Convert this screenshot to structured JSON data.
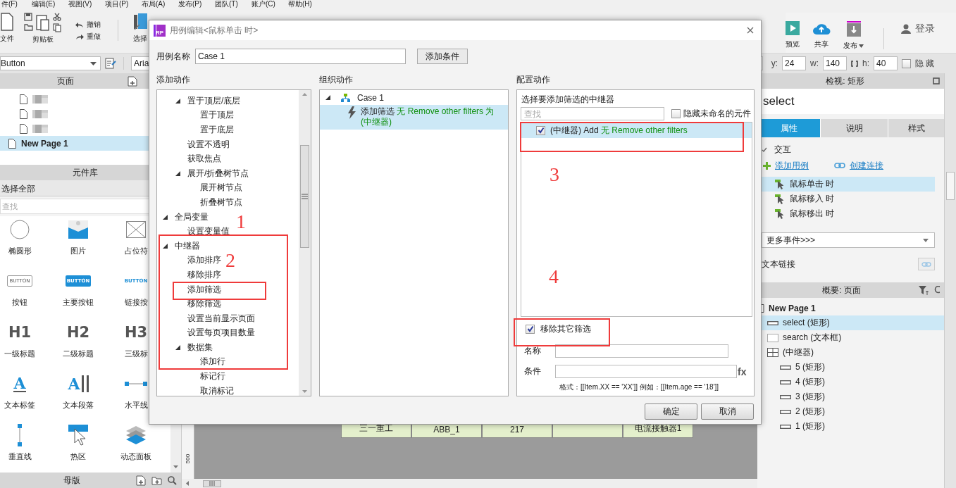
{
  "menu_bar": [
    "件(F)",
    "编辑(E)",
    "视图(V)",
    "项目(P)",
    "布局(A)",
    "发布(P)",
    "团队(T)",
    "账户(C)",
    "帮助(H)"
  ],
  "toolbar": {
    "left": [
      {
        "kind": "file",
        "label": "文件"
      },
      {
        "kind": "clipboard",
        "label": "剪贴板"
      },
      {
        "kind": "history",
        "items": [
          "撤销",
          "重做"
        ]
      },
      {
        "kind": "select",
        "label": "选择"
      }
    ],
    "right": [
      {
        "kind": "preview",
        "label": "预览"
      },
      {
        "kind": "share",
        "label": "共享"
      },
      {
        "kind": "publish",
        "label": "发布"
      }
    ],
    "login": "登录"
  },
  "property_bar": {
    "widget_type": "Button",
    "font": "Aria",
    "fields": [
      {
        "label": "y:",
        "value": "24"
      },
      {
        "label": "w:",
        "value": "140"
      },
      {
        "label": "h:",
        "value": "40"
      }
    ],
    "hidden": {
      "label": "隐藏",
      "checked": false
    }
  },
  "pages_panel": {
    "title": "页面",
    "pages": [
      {
        "kind": "obscured",
        "selected": false
      },
      {
        "kind": "obscured",
        "selected": false
      },
      {
        "kind": "obscured",
        "selected": false
      },
      {
        "kind": "page",
        "label": "New Page 1",
        "selected": true
      }
    ]
  },
  "library_panel": {
    "title": "元件库",
    "library": "选择全部",
    "search_placeholder": "查找",
    "widgets": [
      {
        "kind": "ellipse",
        "label": "椭圆形"
      },
      {
        "kind": "image",
        "label": "图片"
      },
      {
        "kind": "placeholder",
        "label": "占位符"
      },
      {
        "kind": "button",
        "glyph": "BUTTON",
        "label": "按钮"
      },
      {
        "kind": "primary-button",
        "glyph": "BUTTON",
        "label": "主要按钮"
      },
      {
        "kind": "link-button",
        "glyph": "BUTTON",
        "label": "链接按"
      },
      {
        "kind": "heading",
        "glyph": "H1",
        "label": "一级标题"
      },
      {
        "kind": "heading",
        "glyph": "H2",
        "label": "二级标题"
      },
      {
        "kind": "heading",
        "glyph": "H3",
        "label": "三级标"
      },
      {
        "kind": "text-label",
        "glyph": "A",
        "label": "文本标签"
      },
      {
        "kind": "paragraph",
        "glyph": "A",
        "label": "文本段落"
      },
      {
        "kind": "hline",
        "label": "水平线"
      },
      {
        "kind": "vline",
        "label": "垂直线"
      },
      {
        "kind": "hotspot",
        "label": "热区"
      },
      {
        "kind": "dynamic-panel",
        "label": "动态面板"
      }
    ]
  },
  "masters_panel": {
    "title": "母版"
  },
  "canvas": {
    "ruler_label": "500",
    "table_cells": [
      {
        "text": "三一重工"
      },
      {
        "text": "ABB_1"
      },
      {
        "text": "217"
      },
      {},
      {
        "text": "电流接触器1"
      }
    ]
  },
  "inspector": {
    "title": "检视: 矩形",
    "name": "select",
    "tabs": [
      {
        "label": "属性",
        "selected": true
      },
      {
        "label": "说明",
        "selected": false
      },
      {
        "label": "样式",
        "selected": false
      }
    ],
    "section": "交互",
    "add_case": "添加用例",
    "create_link": "创建连接",
    "events": [
      {
        "label": "鼠标单击 时",
        "selected": true
      },
      {
        "label": "鼠标移入 时",
        "selected": false
      },
      {
        "label": "鼠标移出 时",
        "selected": false
      }
    ],
    "more_events": "更多事件>>>",
    "text_link": "文本链接"
  },
  "outline": {
    "title": "概要: 页面",
    "tree": [
      {
        "kind": "page",
        "label": "New Page 1",
        "selected": false,
        "children": [
          {
            "kind": "rect",
            "label": "select (矩形)",
            "selected": true
          },
          {
            "kind": "textbox",
            "label": "search (文本框)",
            "selected": false
          },
          {
            "kind": "repeater",
            "label": "(中继器)",
            "selected": false,
            "children": [
              {
                "kind": "rect",
                "label": "5 (矩形)",
                "selected": false
              },
              {
                "kind": "rect",
                "label": "4 (矩形)",
                "selected": false
              },
              {
                "kind": "rect",
                "label": "3 (矩形)",
                "selected": false
              },
              {
                "kind": "rect",
                "label": "2 (矩形)",
                "selected": false
              },
              {
                "kind": "rect",
                "label": "1 (矩形)",
                "selected": false
              }
            ]
          }
        ]
      }
    ]
  },
  "dialog": {
    "logo": "RP",
    "title": "用例编辑<鼠标单击 时>",
    "case_name_label": "用例名称",
    "case_name": "Case 1",
    "add_condition": "添加条件",
    "add_actions": {
      "title": "添加动作",
      "tree": [
        {
          "children": [
            {
              "label": "置于顶层/底层",
              "expanded": true,
              "children": [
                {
                  "label": "置于顶层"
                },
                {
                  "label": "置于底层"
                }
              ]
            },
            {
              "label": "设置不透明"
            },
            {
              "label": "获取焦点"
            },
            {
              "label": "展开/折叠树节点",
              "expanded": true,
              "children": [
                {
                  "label": "展开树节点"
                },
                {
                  "label": "折叠树节点"
                }
              ]
            }
          ]
        },
        {
          "label": "全局变量",
          "expanded": true,
          "children": [
            {
              "label": "设置变量值"
            }
          ]
        },
        {
          "label": "中继器",
          "expanded": true,
          "children": [
            {
              "label": "添加排序"
            },
            {
              "label": "移除排序"
            },
            {
              "label": "添加筛选"
            },
            {
              "label": "移除筛选"
            },
            {
              "label": "设置当前显示页面"
            },
            {
              "label": "设置每页项目数量"
            },
            {
              "label": "数据集",
              "expanded": true,
              "children": [
                {
                  "label": "添加行"
                },
                {
                  "label": "标记行"
                },
                {
                  "label": "取消标记"
                }
              ]
            }
          ]
        }
      ]
    },
    "organize": {
      "title": "组织动作",
      "tree": [
        {
          "label": "Case 1",
          "expanded": true,
          "children": [
            {
              "action": "添加筛选",
              "detail": "无 Remove other filters 为 (中继器)",
              "selected": true
            }
          ]
        }
      ]
    },
    "configure": {
      "title": "配置动作",
      "prompt": "选择要添加筛选的中继器",
      "search_placeholder": "查找",
      "hide_unnamed": {
        "label": "隐藏未命名的元件",
        "checked": false
      },
      "targets": [
        {
          "name": "(中继器) Add",
          "detail": "无 Remove other filters",
          "checked": true,
          "selected": true
        }
      ],
      "remove_others": {
        "label": "移除其它筛选",
        "checked": true
      },
      "name_label": "名称",
      "condition_label": "条件",
      "fx": "fx",
      "hint": "格式：[[Item.XX == 'XX']]  例如：[[Item.age == '18']]"
    },
    "buttons": [
      "确定",
      "取消"
    ]
  },
  "annotations": [
    {
      "kind": "box"
    },
    {
      "kind": "box"
    },
    {
      "kind": "box"
    },
    {
      "kind": "box"
    },
    {
      "kind": "number",
      "text": "1"
    },
    {
      "kind": "number",
      "text": "2"
    },
    {
      "kind": "number",
      "text": "3"
    },
    {
      "kind": "number",
      "text": "4"
    }
  ]
}
